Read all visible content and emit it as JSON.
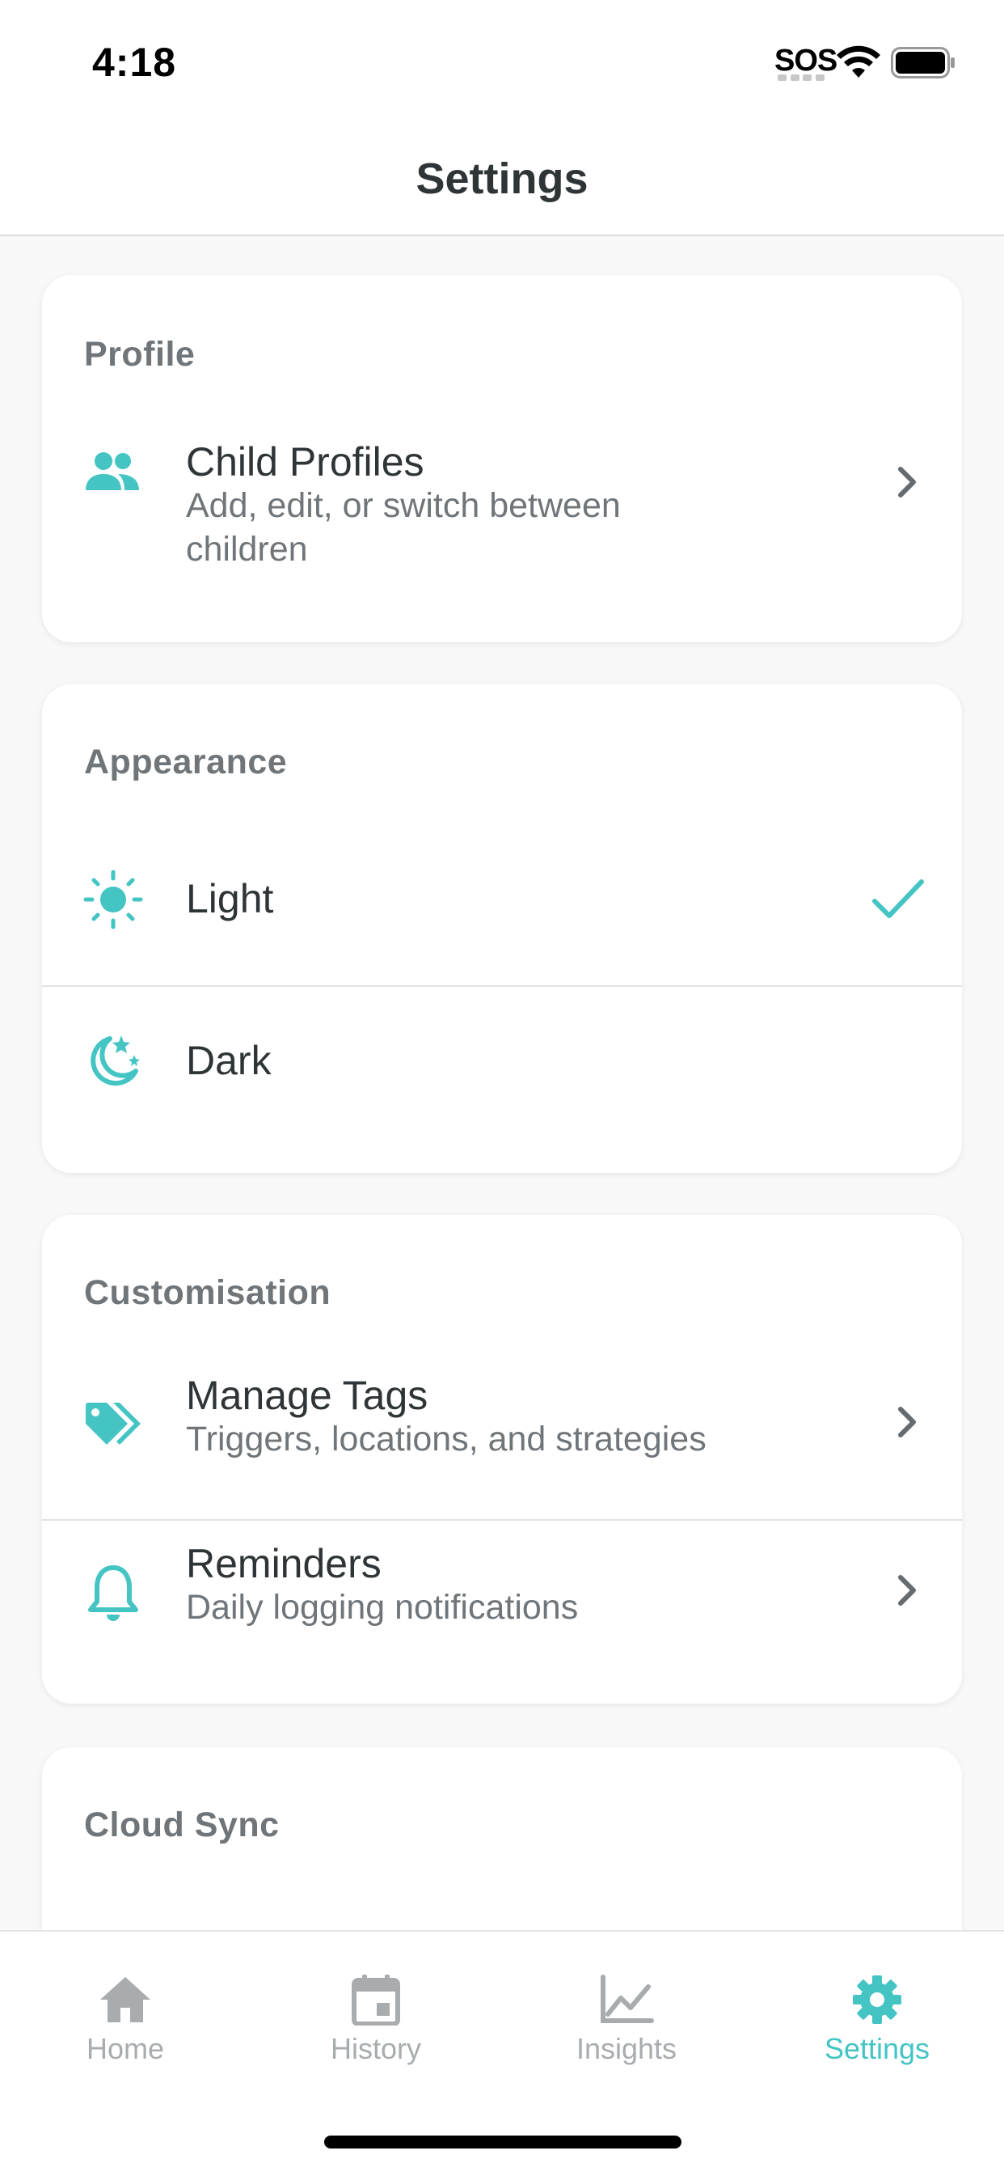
{
  "status_bar": {
    "time": "4:18",
    "sos": "SOS",
    "wifi_icon": "wifi-icon",
    "battery_icon": "battery-full-icon"
  },
  "nav": {
    "title": "Settings"
  },
  "sections": {
    "profile": {
      "title": "Profile",
      "items": [
        {
          "icon": "people-icon",
          "title": "Child Profiles",
          "subtitle": "Add, edit, or switch between children"
        }
      ]
    },
    "appearance": {
      "title": "Appearance",
      "items": [
        {
          "icon": "sun-icon",
          "title": "Light",
          "selected": true
        },
        {
          "icon": "moon-stars-icon",
          "title": "Dark",
          "selected": false
        }
      ]
    },
    "customisation": {
      "title": "Customisation",
      "items": [
        {
          "icon": "tags-icon",
          "title": "Manage Tags",
          "subtitle": "Triggers, locations, and strategies"
        },
        {
          "icon": "bell-icon",
          "title": "Reminders",
          "subtitle": "Daily logging notifications"
        }
      ]
    },
    "cloud_sync": {
      "title": "Cloud Sync"
    }
  },
  "tab_bar": {
    "tabs": [
      {
        "label": "Home",
        "icon": "home-icon",
        "active": false
      },
      {
        "label": "History",
        "icon": "calendar-icon",
        "active": false
      },
      {
        "label": "Insights",
        "icon": "chart-line-icon",
        "active": false
      },
      {
        "label": "Settings",
        "icon": "gear-icon",
        "active": true
      }
    ]
  },
  "colors": {
    "accent": "#45c4c4",
    "text_primary": "#2f3437",
    "text_secondary": "#70757a",
    "section_title": "#707579",
    "tab_inactive": "#a8acaf",
    "background": "#f8f8f8"
  }
}
